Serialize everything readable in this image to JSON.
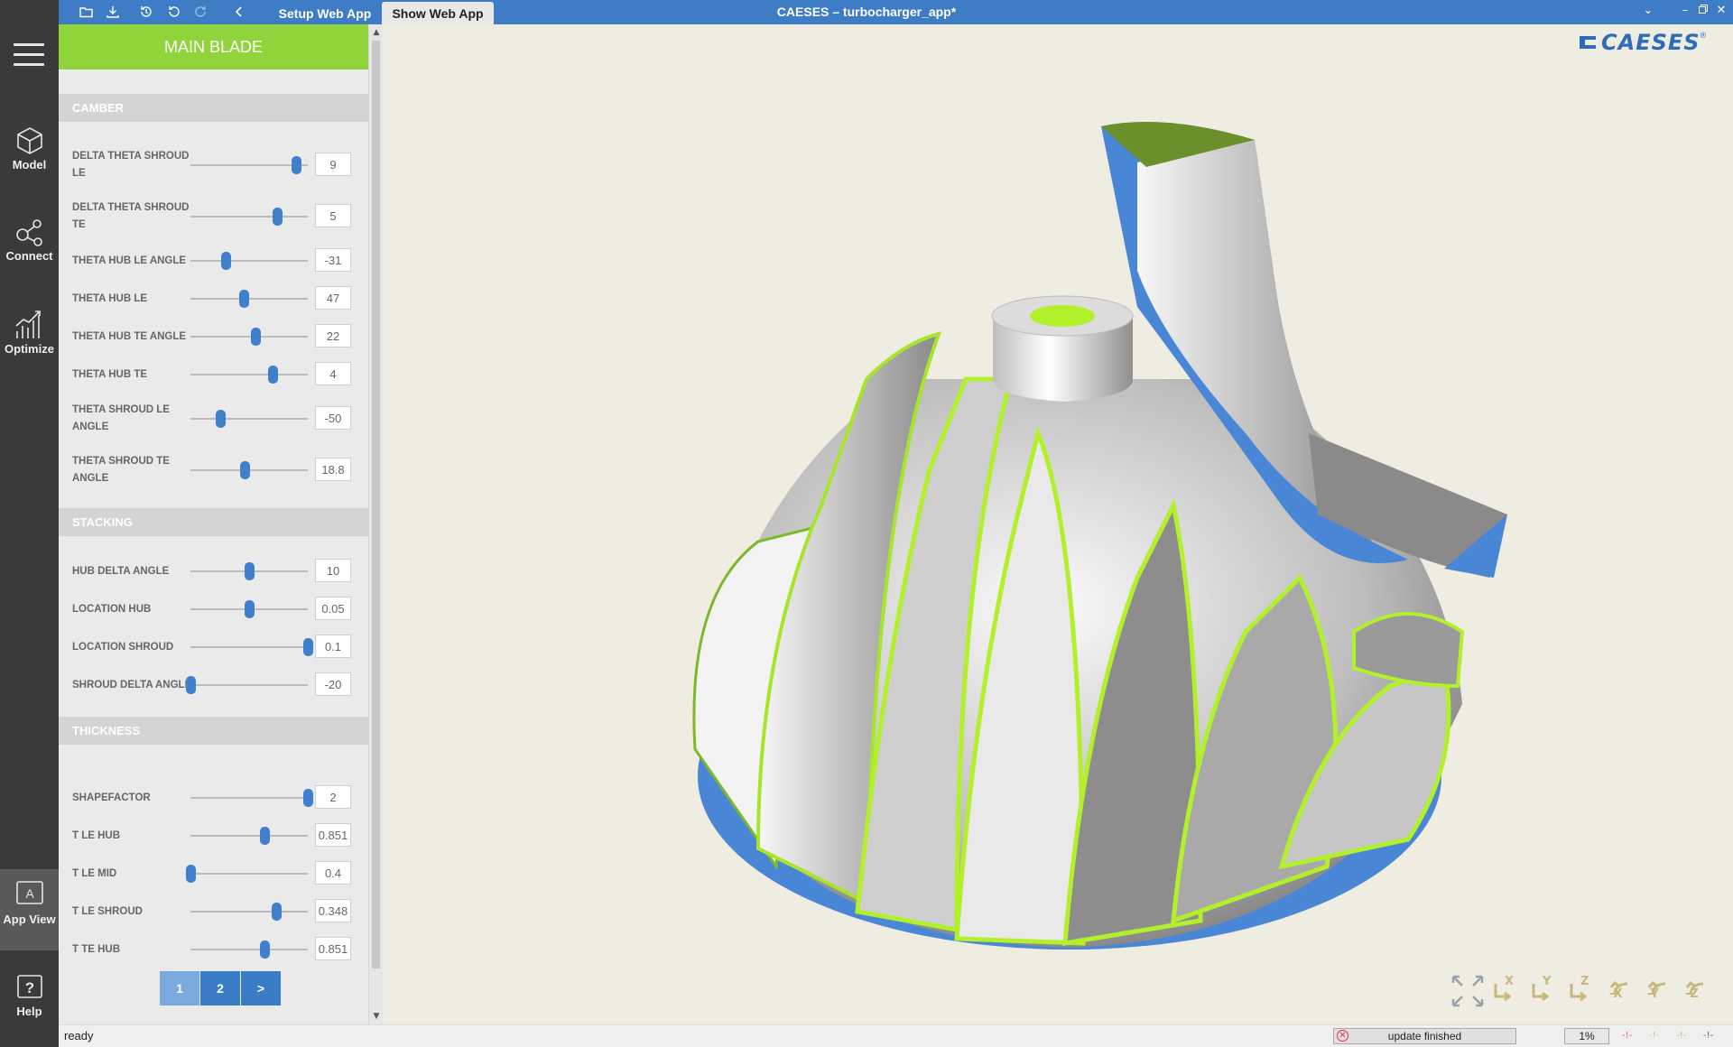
{
  "titlebar": {
    "title": "CAESES – turbocharger_app*",
    "tabs": [
      {
        "label": "Setup Web App"
      },
      {
        "label": "Show Web App"
      }
    ]
  },
  "nav": {
    "items": [
      {
        "label": "Model",
        "icon": "cube-icon"
      },
      {
        "label": "Connect",
        "icon": "nodes-icon"
      },
      {
        "label": "Optimize",
        "icon": "chart-icon"
      },
      {
        "label": "App View",
        "icon": "app-view-icon"
      },
      {
        "label": "Help",
        "icon": "help-icon"
      }
    ]
  },
  "panel": {
    "header": "MAIN BLADE",
    "sections": {
      "camber": "CAMBER",
      "stacking": "STACKING",
      "thickness": "THICKNESS"
    },
    "params": [
      {
        "label": "DELTA THETA SHROUD LE",
        "value": "9",
        "level": 0.9
      },
      {
        "label": "DELTA THETA SHROUD TE",
        "value": "5",
        "level": 0.74
      },
      {
        "label": "THETA HUB LE ANGLE",
        "value": "-31",
        "level": 0.3
      },
      {
        "label": "THETA HUB LE",
        "value": "47",
        "level": 0.45
      },
      {
        "label": "THETA HUB TE ANGLE",
        "value": "22",
        "level": 0.55
      },
      {
        "label": "THETA HUB TE",
        "value": "4",
        "level": 0.7
      },
      {
        "label": "THETA SHROUD LE ANGLE",
        "value": "-50",
        "level": 0.25
      },
      {
        "label": "THETA SHROUD TE ANGLE",
        "value": "18.8",
        "level": 0.46
      },
      {
        "label": "HUB DELTA ANGLE",
        "value": "10",
        "level": 0.5
      },
      {
        "label": "LOCATION HUB",
        "value": "0.05",
        "level": 0.5
      },
      {
        "label": "LOCATION SHROUD",
        "value": "0.1",
        "level": 1.0
      },
      {
        "label": "SHROUD DELTA ANGLE",
        "value": "-20",
        "level": 0.0
      },
      {
        "label": "SHAPEFACTOR",
        "value": "2",
        "level": 1.0
      },
      {
        "label": "T LE HUB",
        "value": "0.851",
        "level": 0.63
      },
      {
        "label": "T LE MID",
        "value": "0.4",
        "level": 0.0
      },
      {
        "label": "T LE SHROUD",
        "value": "0.348",
        "level": 0.73
      },
      {
        "label": "T TE HUB",
        "value": "0.851",
        "level": 0.63
      }
    ],
    "pager": [
      "1",
      "2",
      ">"
    ]
  },
  "viewport": {
    "logo": "CAESES",
    "logo_mark": "®",
    "view_tools": [
      {
        "label": "",
        "icon": "fit-view-icon"
      },
      {
        "label": "X",
        "icon": "view-x-icon"
      },
      {
        "label": "Y",
        "icon": "view-y-icon"
      },
      {
        "label": "Z",
        "icon": "view-z-icon"
      },
      {
        "label": "-X",
        "icon": "view-neg-x-icon"
      },
      {
        "label": "-Y",
        "icon": "view-neg-y-icon"
      },
      {
        "label": "-Z",
        "icon": "view-neg-z-icon"
      }
    ]
  },
  "status": {
    "text": "ready",
    "update": "update finished",
    "percent": "1%"
  },
  "colors": {
    "accent": "#3e7cc6",
    "header_green": "#8fd43a",
    "blade_green": "#b3f02c",
    "blade_blue": "#4a86d6"
  }
}
